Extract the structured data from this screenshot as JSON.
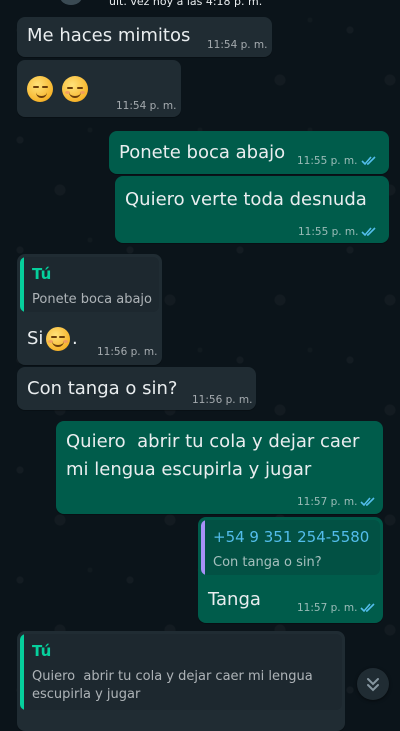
{
  "header": {
    "last_seen": "últ. vez hoy a las 4:18 p. m."
  },
  "colors": {
    "incoming_bubble": "#202c33",
    "outgoing_bubble": "#005c4b",
    "read_ticks": "#53bdeb",
    "quote_author_in": "#06cf9c",
    "quote_author_out": "#53bdeb",
    "quote_bar_out": "#a791f8"
  },
  "messages": [
    {
      "text": "Me haces mimitos",
      "time": "11:54 p. m."
    },
    {
      "emojis": [
        "smirking-face",
        "relieved-face"
      ],
      "time": "11:54 p. m."
    },
    {
      "text": "Ponete boca abajo",
      "time": "11:55 p. m.",
      "status": "read"
    },
    {
      "text": "Quiero verte toda desnuda",
      "time": "11:55 p. m.",
      "status": "read"
    },
    {
      "quote_author": "Tú",
      "quote_text": "Ponete boca abajo",
      "text": "Si",
      "time": "11:56 p. m."
    },
    {
      "text": "Con tanga o sin?",
      "time": "11:56 p. m."
    },
    {
      "text_line1": "Quiero  abrir tu cola y dejar caer",
      "text_line2": "mi lengua escupirla y jugar",
      "time": "11:57 p. m.",
      "status": "read"
    },
    {
      "quote_author": "+54 9 351 254-5580",
      "quote_text": "Con tanga o sin?",
      "text": "Tanga",
      "time": "11:57 p. m.",
      "status": "read"
    },
    {
      "quote_author": "Tú",
      "quote_line1": "Quiero  abrir tu cola y dejar caer mi lengua",
      "quote_line2": "escupirla y jugar"
    }
  ]
}
